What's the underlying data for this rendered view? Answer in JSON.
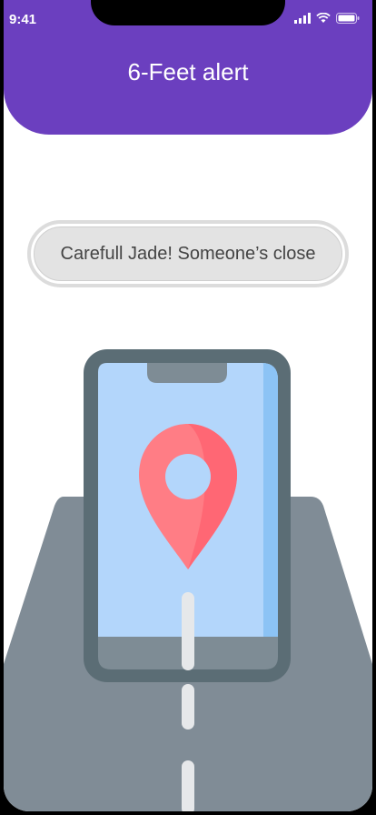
{
  "status_bar": {
    "time": "9:41"
  },
  "header": {
    "title": "6-Feet alert"
  },
  "alert": {
    "message": "Carefull Jade! Someone’s close"
  },
  "colors": {
    "header_bg": "#6b3fbf",
    "road": "#808c96",
    "phone_frame": "#5b6d75",
    "phone_screen": "#b3d6fb",
    "pin": "#ff7d85"
  },
  "icons": [
    "cellular-signal-icon",
    "wifi-icon",
    "battery-icon",
    "location-pin-icon"
  ]
}
